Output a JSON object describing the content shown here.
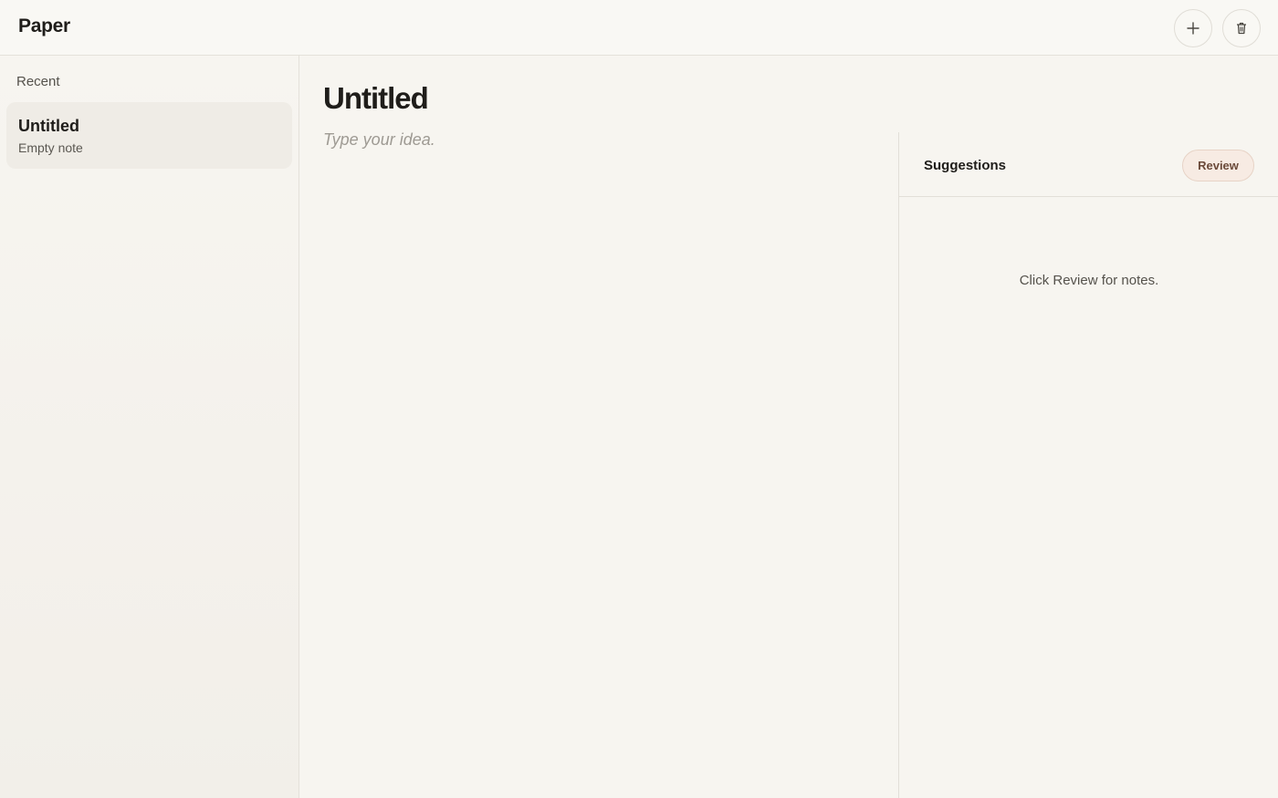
{
  "app": {
    "title": "Paper"
  },
  "toolbar": {
    "add_icon": "plus-icon",
    "delete_icon": "trash-icon"
  },
  "sidebar": {
    "section_label": "Recent",
    "notes": [
      {
        "title": "Untitled",
        "subtitle": "Empty note"
      }
    ]
  },
  "editor": {
    "title": "Untitled",
    "placeholder": "Type your idea.",
    "body": ""
  },
  "suggestions": {
    "title": "Suggestions",
    "review_label": "Review",
    "empty_message": "Click Review for notes."
  },
  "colors": {
    "background": "#f7f5f0",
    "review_button_bg": "#f7ebe3",
    "review_button_text": "#6b4a3a"
  }
}
